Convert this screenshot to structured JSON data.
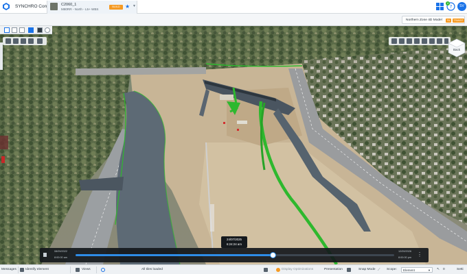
{
  "titlebar": {
    "app_title": "SYNCHRO Control",
    "tab": {
      "name": "C2060_1",
      "subtitle": "M80RR - North - L5+ WBS",
      "badge": "BUILD"
    },
    "user_initials": "SV",
    "notification_count": "4"
  },
  "subbar": {
    "model_name": "Northern Zone 4D Model",
    "badge1": "FA",
    "badge2": "TRANSIT"
  },
  "viewcube": {
    "face_label": "Back"
  },
  "timeline": {
    "start_date": "08/09/2022",
    "start_time": "8:00:00 am",
    "end_date": "12/09/2026",
    "end_time": "8:00:00 pm",
    "current_date": "24/07/2025",
    "current_time": "6:24:24 am",
    "progress": 0.62
  },
  "statusbar": {
    "messages": "Messages",
    "identify": "Identify element",
    "views": "Views",
    "tiles": "All tiles loaded",
    "display_opt": "Display Optimizations",
    "presentation": "Presentation",
    "snap": "Snap Mode",
    "scope_label": "Scope:",
    "scope_value": "Element",
    "count": "0",
    "settings": "Setti"
  },
  "colors": {
    "accent": "#2e8de8",
    "badge": "#f59a23",
    "progress_green": "#2eb82e"
  }
}
